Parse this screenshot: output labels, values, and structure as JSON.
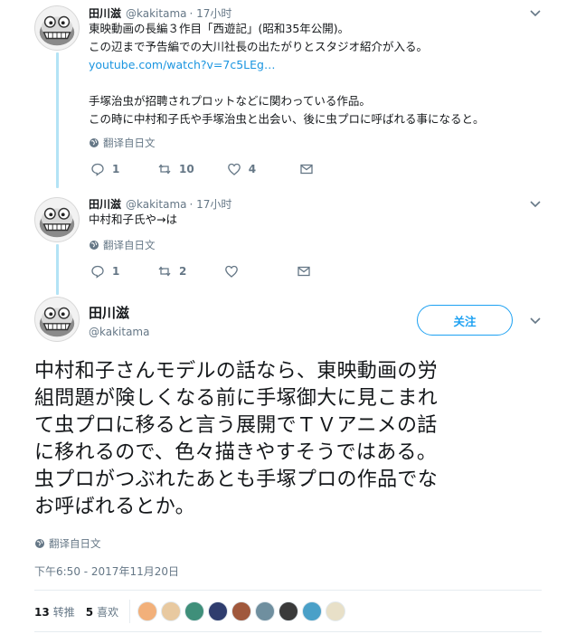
{
  "tweets": [
    {
      "name": "田川滋",
      "handle": "@kakitama",
      "time": "· 17小时",
      "lines": [
        "東映動画の長編３作目「西遊記」(昭和35年公開)。",
        "この辺まで予告編での大川社長の出たがりとスタジオ紹介が入る。",
        "youtube.com/watch?v=7c5LEg…",
        "",
        "手塚治虫が招聘されプロットなどに関わっている作品。",
        "この時に中村和子氏や手塚治虫と出会い、後に虫プロに呼ばれる事になると。"
      ],
      "translate": "翻译自日文",
      "replies": "1",
      "retweets": "10",
      "likes": "4"
    },
    {
      "name": "田川滋",
      "handle": "@kakitama",
      "time": "· 17小时",
      "lines": [
        "中村和子氏や→は"
      ],
      "translate": "翻译自日文",
      "replies": "1",
      "retweets": "2",
      "likes": ""
    }
  ],
  "main": {
    "name": "田川滋",
    "handle": "@kakitama",
    "follow_label": "关注",
    "lines": [
      "中村和子さんモデルの話なら、東映動画の労",
      "組問題が険しくなる前に手塚御大に見こまれ",
      "て虫プロに移ると言う展開でＴＶアニメの話",
      "に移れるので、色々描きやすそうではある。",
      "虫プロがつぶれたあとも手塚プロの作品でな",
      "お呼ばれるとか。"
    ],
    "translate": "翻译自日文",
    "timestamp": "下午6:50 - 2017年11月20日",
    "retweet_count": "13",
    "retweet_label": "转推",
    "like_count": "5",
    "like_label": "喜欢",
    "liker_colors": [
      "#f2b07a",
      "#e8c9a0",
      "#3f8f7a",
      "#2f3d6e",
      "#a0583c",
      "#6f8f9f",
      "#3a3a3a",
      "#4aa0c8",
      "#e8e0c8"
    ]
  },
  "colors": {
    "accent": "#1da1f2",
    "link": "#1b95e0",
    "muted": "#657786",
    "thread": "#b3e3f5"
  },
  "icons": [
    "reply-icon",
    "retweet-icon",
    "like-icon",
    "message-icon",
    "globe-icon",
    "chevron-down-icon"
  ]
}
